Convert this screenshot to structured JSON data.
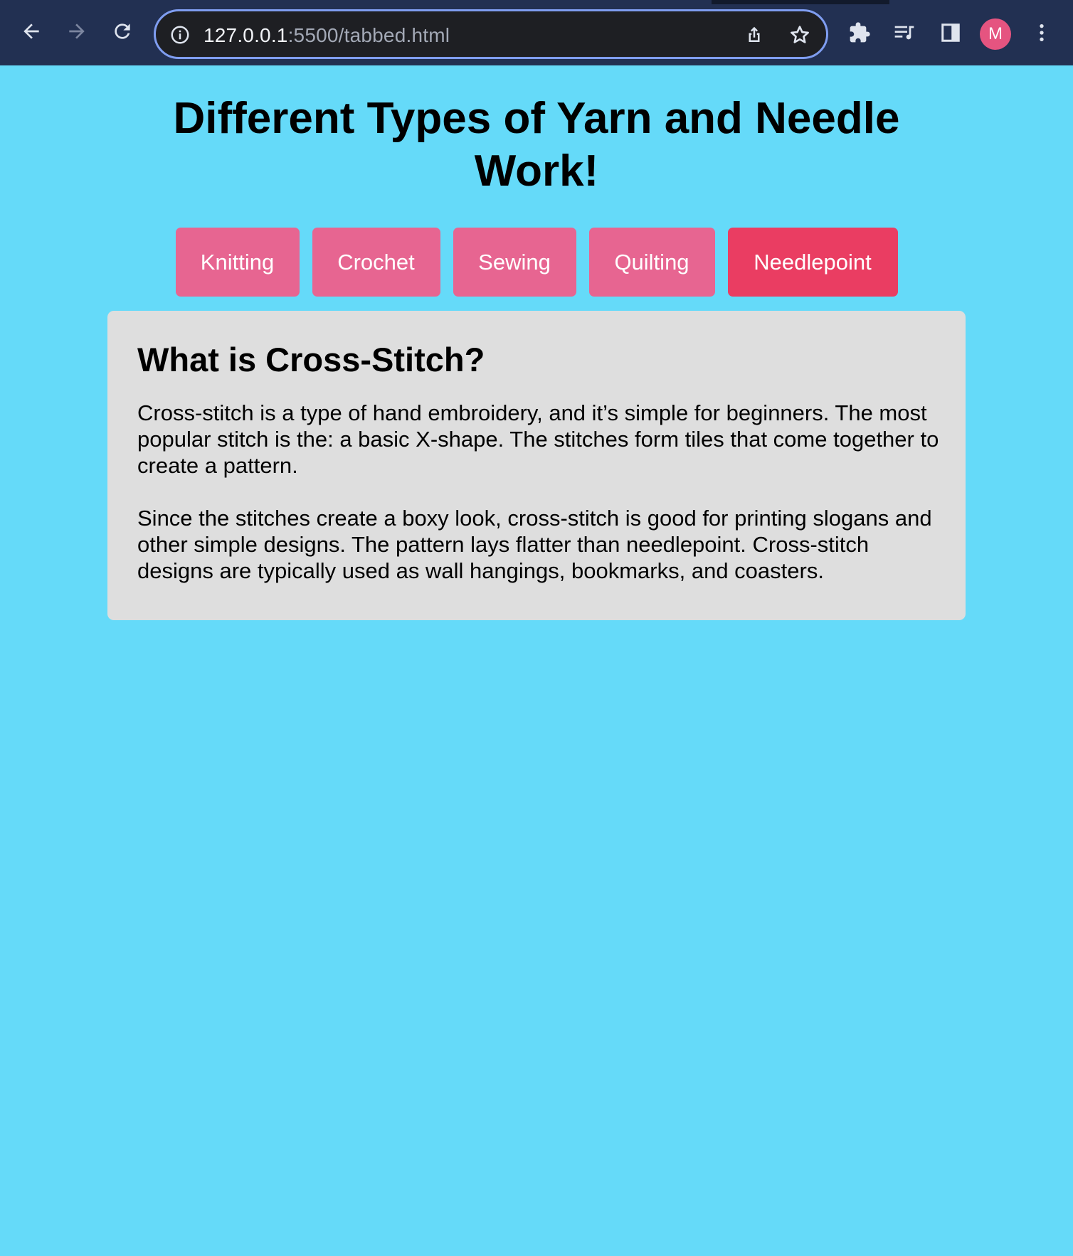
{
  "browser": {
    "url_host": "127.0.0.1",
    "url_path": ":5500/tabbed.html",
    "profile_initial": "M",
    "accent_color": "#7f9df0"
  },
  "page": {
    "title": "Different Types of Yarn and Needle Work!",
    "background_color": "#65daf9"
  },
  "tabs": [
    {
      "label": "Knitting",
      "active": false
    },
    {
      "label": "Crochet",
      "active": false
    },
    {
      "label": "Sewing",
      "active": false
    },
    {
      "label": "Quilting",
      "active": false
    },
    {
      "label": "Needlepoint",
      "active": true
    }
  ],
  "tab_colors": {
    "default": "#e76591",
    "active": "#ea3d62"
  },
  "content": {
    "heading": "What is Cross-Stitch?",
    "paragraphs": [
      "Cross-stitch is a type of hand embroidery, and it’s simple for beginners. The most popular stitch is the: a basic X-shape. The stitches form tiles that come together to create a pattern.",
      "Since the stitches create a boxy look, cross-stitch is good for printing slogans and other simple designs. The pattern lays flatter than needlepoint. Cross-stitch designs are typically used as wall hangings, bookmarks, and coasters."
    ]
  },
  "icons": {
    "nav": [
      "back-arrow-icon",
      "forward-arrow-icon",
      "reload-icon"
    ],
    "omnibox": [
      "info-icon",
      "share-icon",
      "star-icon"
    ],
    "toolbar": [
      "extensions-puzzle-icon",
      "media-queue-icon",
      "side-panel-icon",
      "more-vert-icon"
    ]
  }
}
